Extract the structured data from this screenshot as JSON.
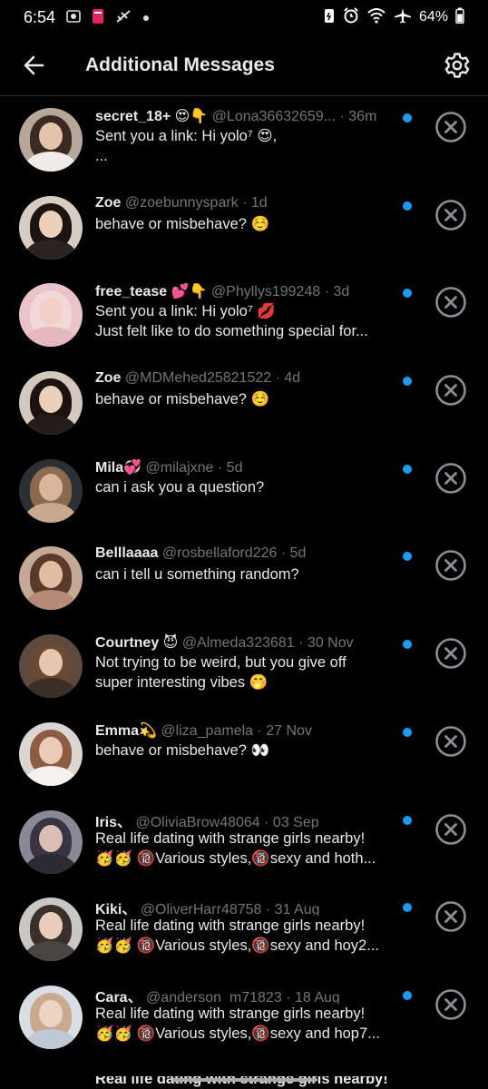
{
  "status": {
    "time": "6:54",
    "left_icons": [
      "gallery-icon",
      "pay-icon",
      "signal-slash-icon",
      "dot-icon"
    ],
    "battery": "64%"
  },
  "header": {
    "title": "Additional Messages"
  },
  "colors": {
    "unread_dot": "#1d9bf0",
    "muted": "#71767b",
    "background": "#000000"
  },
  "messages": [
    {
      "name": "secret_18+ 😍👇",
      "handle": "@Lona36632659...",
      "time": "· 36m",
      "line1": "Sent you a link: Hi yolo⁷ 😍,",
      "line2": "...",
      "avatar": {
        "bg": "#b7a79a",
        "hair": "#3a2a22",
        "face": "#e4c3ad",
        "body": "#f1ece8"
      }
    },
    {
      "name": "Zoe",
      "handle": "@zoebunnyspark",
      "time": "· 1d",
      "line1": "behave or misbehave? ☺️",
      "line2": "",
      "avatar": {
        "bg": "#d6ccc4",
        "hair": "#1b1411",
        "face": "#ecd0bc",
        "body": "#2a2321"
      }
    },
    {
      "name": "free_tease 💕👇",
      "handle": "@Phyllys199248",
      "time": "· 3d",
      "line1": "Sent you a link: Hi yolo⁷ 💋",
      "line2": "Just felt like to do something special for...",
      "avatar": {
        "bg": "#e9c5c9",
        "hair": "#f0d9d6",
        "face": "#f3cfc6",
        "body": "#e7b7bf"
      }
    },
    {
      "name": "Zoe",
      "handle": "@MDMehed25821522",
      "time": "· 4d",
      "line1": "behave or misbehave? ☺️",
      "line2": "",
      "avatar": {
        "bg": "#d2c8bf",
        "hair": "#1a1310",
        "face": "#ebcfbb",
        "body": "#241d1a"
      }
    },
    {
      "name": "Mila💞",
      "handle": "@milajxne",
      "time": "· 5d",
      "line1": "can i ask you a question?",
      "line2": "",
      "avatar": {
        "bg": "#2b3034",
        "hair": "#8c6a4e",
        "face": "#d9b59b",
        "body": "#c9a98e"
      }
    },
    {
      "name": "Belllaaaa",
      "handle": "@rosbellaford226",
      "time": "· 5d",
      "line1": "can i tell u something random?",
      "line2": "",
      "avatar": {
        "bg": "#c4a996",
        "hair": "#5a3a2a",
        "face": "#e2bba3",
        "body": "#b58b77"
      }
    },
    {
      "name": "Courtney 😈",
      "handle": "@Almeda323681",
      "time": "· 30 Nov",
      "line1": "Not trying to be weird, but you give off",
      "line2": "super interesting vibes 🤭",
      "avatar": {
        "bg": "#5d4a3e",
        "hair": "#6b4a35",
        "face": "#e7c6b0",
        "body": "#3c2f28"
      }
    },
    {
      "name": "Emma💫",
      "handle": "@liza_pamela",
      "time": "· 27 Nov",
      "line1": "behave or misbehave? 👀",
      "line2": "",
      "avatar": {
        "bg": "#dcd6d2",
        "hair": "#8e5b45",
        "face": "#ecccb8",
        "body": "#f4f1ef"
      }
    },
    {
      "name": "Iris、",
      "handle": "@OliviaBrow48064",
      "time": "· 03 Sep",
      "line1": "Real life dating with strange girls nearby!",
      "line2": "🥳🥳 🔞Various styles,🔞sexy and hoth...",
      "avatar": {
        "bg": "#8a8896",
        "hair": "#3a3440",
        "face": "#d8c0b4",
        "body": "#2c2a32"
      }
    },
    {
      "name": "Kiki、",
      "handle": "@OliverHarr48758",
      "time": "· 31 Aug",
      "line1": "Real life dating with strange girls nearby!",
      "line2": "🥳🥳 🔞Various styles,🔞sexy and hoy2...",
      "avatar": {
        "bg": "#c9c6c3",
        "hair": "#3b2f2a",
        "face": "#e6cdbd",
        "body": "#4a4543"
      }
    },
    {
      "name": "Cara、",
      "handle": "@anderson_m71823",
      "time": "· 18 Aug",
      "line1": "Real life dating with strange girls nearby!",
      "line2": "🥳🥳 🔞Various styles,🔞sexy and hop7...",
      "avatar": {
        "bg": "#d9dee4",
        "hair": "#caa98f",
        "face": "#ecd3c3",
        "body": "#bfc9d6"
      }
    }
  ],
  "partial_row": {
    "line1": "Real life dating with strange girls nearby!"
  }
}
